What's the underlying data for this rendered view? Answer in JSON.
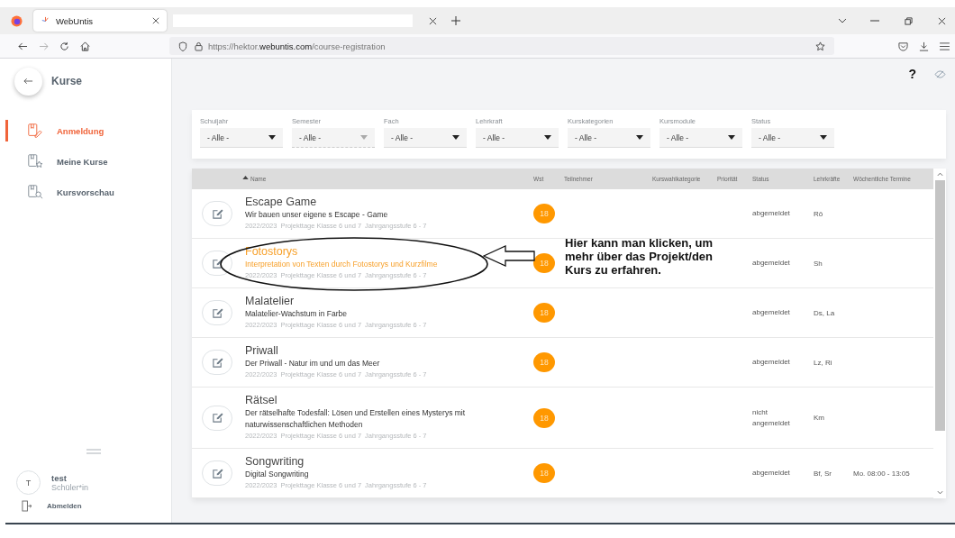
{
  "browser": {
    "tab": {
      "title": "WebUntis"
    },
    "url": "https://hektor.**webuntis.com**/course-registration"
  },
  "sidebar": {
    "title": "Kurse",
    "items": [
      {
        "label": "Anmeldung",
        "kind": "register",
        "selected": true
      },
      {
        "label": "Meine Kurse",
        "kind": "favorites",
        "selected": false
      },
      {
        "label": "Kursvorschau",
        "kind": "preview",
        "selected": false
      }
    ],
    "user": {
      "initial": "T",
      "name": "test",
      "role": "Schüler*in"
    },
    "logout": "Abmelden"
  },
  "help": "?",
  "filters": [
    {
      "label": "Schuljahr",
      "value": "- Alle -",
      "disabled": false
    },
    {
      "label": "Semester",
      "value": "- Alle -",
      "disabled": true
    },
    {
      "label": "Fach",
      "value": "- Alle -",
      "disabled": false
    },
    {
      "label": "Lehrkraft",
      "value": "- Alle -",
      "disabled": false
    },
    {
      "label": "Kurskategorien",
      "value": "- Alle -",
      "disabled": false
    },
    {
      "label": "Kursmodule",
      "value": "- Alle -",
      "disabled": false
    },
    {
      "label": "Status",
      "value": "- Alle -",
      "disabled": false
    }
  ],
  "table": {
    "columns": [
      {
        "label": "Name",
        "sorted": true
      },
      {
        "label": "Wst",
        "sorted": false
      },
      {
        "label": "Teilnehmer",
        "sorted": false
      },
      {
        "label": "Kurswahlkategorie",
        "sorted": false
      },
      {
        "label": "Priorität",
        "sorted": false
      },
      {
        "label": "Status",
        "sorted": false
      },
      {
        "label": "Lehrkräfte",
        "sorted": false
      },
      {
        "label": "Wöchentliche Termine",
        "sorted": false
      }
    ],
    "rows": [
      {
        "title": "Escape Game",
        "subtitle": "Wir bauen unser eigene s Escape - Game",
        "meta": [
          "2022/2023",
          "Projekttage Klasse 6 und 7",
          "Jahrgangsstufe 6 - 7"
        ],
        "wst": "18",
        "status": "abgemeldet",
        "teachers": "Rö",
        "highlighted": false
      },
      {
        "title": "Fotostorys",
        "subtitle": "Interpretation von Texten durch Fotostorys und Kurzfilme",
        "meta": [
          "2022/2023",
          "Projekttage Klasse 6 und 7",
          "Jahrgangsstufe 6 - 7"
        ],
        "wst": "18",
        "status": "abgemeldet",
        "teachers": "Sh",
        "highlighted": true
      },
      {
        "title": "Malatelier",
        "subtitle": "Malatelier-Wachstum in Farbe",
        "meta": [
          "2022/2023",
          "Projekttage Klasse 6 und 7",
          "Jahrgangsstufe 6 - 7"
        ],
        "wst": "18",
        "status": "abgemeldet",
        "teachers": "Ds, La",
        "highlighted": false
      },
      {
        "title": "Priwall",
        "subtitle": "Der Priwall - Natur im und um das Meer",
        "meta": [
          "2022/2023",
          "Projekttage Klasse 6 und 7",
          "Jahrgangsstufe 6 - 7"
        ],
        "wst": "18",
        "status": "abgemeldet",
        "teachers": "Lz, Ri",
        "highlighted": false
      },
      {
        "title": "Rätsel",
        "subtitle": "Der rätselhafte Todesfall: Lösen und Erstellen eines Mysterys mit naturwissenschaftlichen Methoden",
        "meta": [
          "2022/2023",
          "Projekttage Klasse 6 und 7",
          "Jahrgangsstufe 6 - 7"
        ],
        "wst": "18",
        "status": "nicht angemeldet",
        "teachers": "Km",
        "highlighted": false
      },
      {
        "title": "Songwriting",
        "subtitle": "Digital Songwriting",
        "meta": [
          "2022/2023",
          "Projekttage Klasse 6 und 7",
          "Jahrgangsstufe 6 - 7"
        ],
        "wst": "18",
        "status": "abgemeldet",
        "teachers": "Bf, Sr",
        "times": "Mo. 08:00 - 13:05",
        "highlighted": false
      }
    ]
  },
  "annotation": {
    "text": "Hier kann man klicken, um mehr über das Projekt/den Kurs zu erfahren."
  }
}
